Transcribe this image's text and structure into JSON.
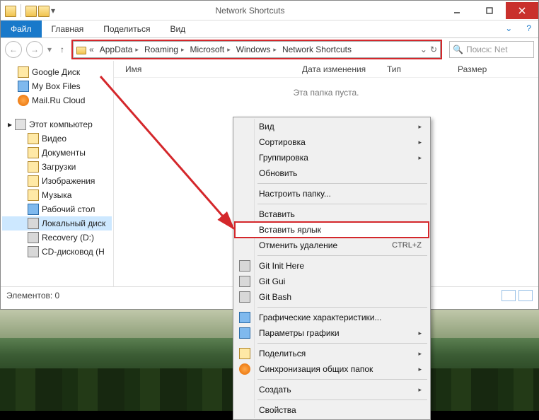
{
  "window": {
    "title": "Network Shortcuts",
    "controls": {
      "min": "–",
      "max": "□",
      "close": "✕"
    }
  },
  "ribbon": {
    "file": "Файл",
    "tabs": [
      "Главная",
      "Поделиться",
      "Вид"
    ]
  },
  "nav": {
    "crumbs": [
      "AppData",
      "Roaming",
      "Microsoft",
      "Windows",
      "Network Shortcuts"
    ],
    "search_placeholder": "Поиск: Net"
  },
  "columns": {
    "name": "Имя",
    "date": "Дата изменения",
    "type": "Тип",
    "size": "Размер"
  },
  "empty_text": "Эта папка пуста.",
  "sidebar": {
    "fav": [
      {
        "label": "Google Диск",
        "icon": "ic-yell"
      },
      {
        "label": "My Box Files",
        "icon": "ic-blu"
      },
      {
        "label": "Mail.Ru Cloud",
        "icon": "ic-orng"
      }
    ],
    "this_pc": "Этот компьютер",
    "pc": [
      {
        "label": "Видео"
      },
      {
        "label": "Документы"
      },
      {
        "label": "Загрузки"
      },
      {
        "label": "Изображения"
      },
      {
        "label": "Музыка"
      },
      {
        "label": "Рабочий стол"
      },
      {
        "label": "Локальный диск",
        "sel": true
      },
      {
        "label": "Recovery (D:)"
      },
      {
        "label": "CD-дисковод (H"
      }
    ]
  },
  "status": {
    "elements": "Элементов: 0"
  },
  "ctx": {
    "view": "Вид",
    "sort": "Сортировка",
    "group": "Группировка",
    "refresh": "Обновить",
    "customize": "Настроить папку...",
    "paste": "Вставить",
    "paste_shortcut": "Вставить ярлык",
    "undo_delete": "Отменить удаление",
    "undo_sc": "CTRL+Z",
    "git_init": "Git Init Here",
    "git_gui": "Git Gui",
    "git_bash": "Git Bash",
    "gfx_char": "Графические характеристики...",
    "gfx_param": "Параметры графики",
    "share": "Поделиться",
    "sync": "Синхронизация общих папок",
    "create": "Создать",
    "properties": "Свойства"
  }
}
